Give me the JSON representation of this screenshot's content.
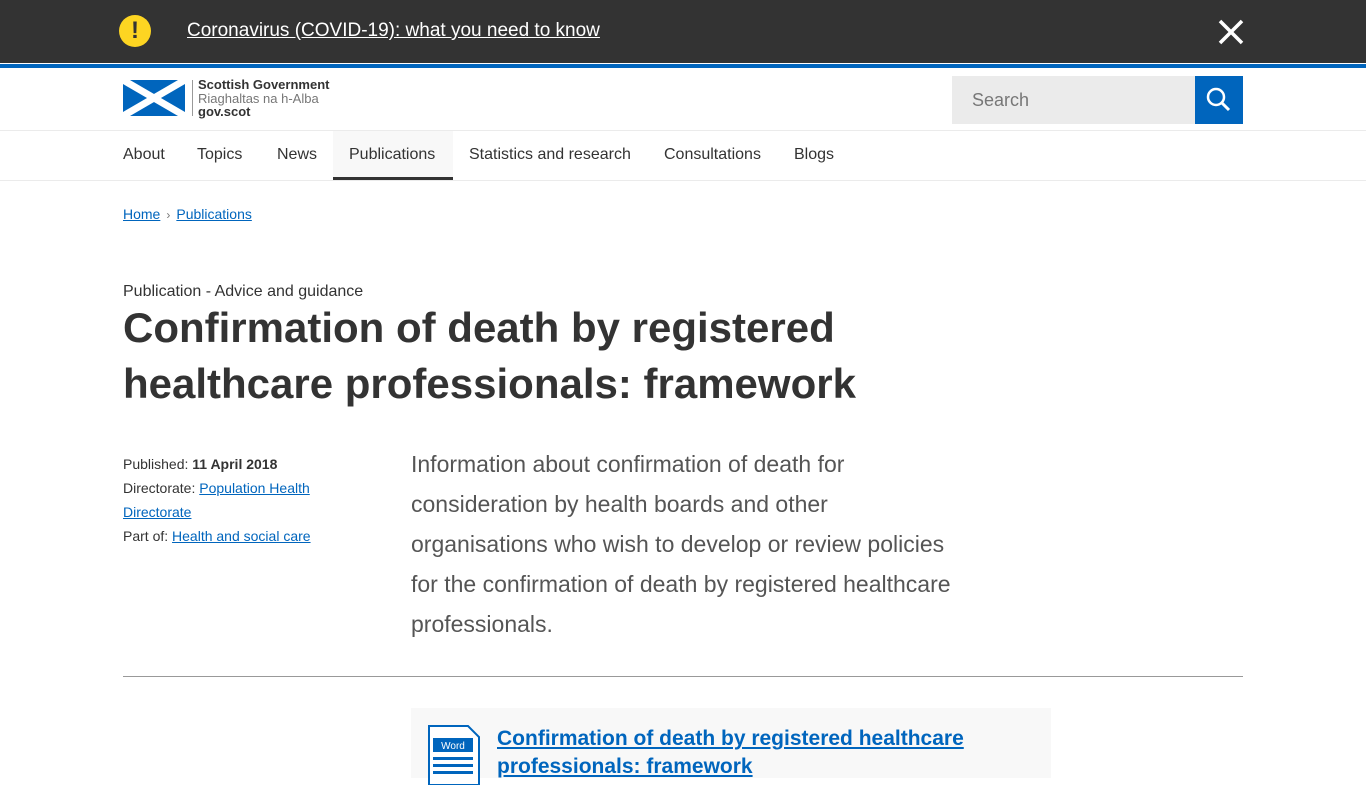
{
  "covid_banner": {
    "icon": "warning-icon",
    "link_text": "Coronavirus (COVID-19): what you need to know",
    "close_icon": "close-icon",
    "colors": {
      "background": "#333333",
      "warning": "#fdd522"
    }
  },
  "header": {
    "logo": {
      "line1": "Scottish Government",
      "line2": "Riaghaltas na h-Alba",
      "line3": "gov.scot"
    },
    "search": {
      "placeholder": "Search",
      "button_icon": "search-icon"
    },
    "brand_color": "#0065bd"
  },
  "nav": {
    "items": [
      {
        "label": "About"
      },
      {
        "label": "Topics"
      },
      {
        "label": "News"
      },
      {
        "label": "Publications",
        "active": true
      },
      {
        "label": "Statistics and research"
      },
      {
        "label": "Consultations"
      },
      {
        "label": "Blogs"
      }
    ]
  },
  "breadcrumb": {
    "items": [
      {
        "label": "Home"
      },
      {
        "label": "Publications"
      }
    ],
    "separator_icon": "chevron-right-icon"
  },
  "page": {
    "label": "Publication - Advice and guidance",
    "title": "Confirmation of death by registered healthcare professionals: framework",
    "meta": {
      "published_label": "Published:",
      "published_value": "11 April 2018",
      "directorate_label": "Directorate:",
      "directorate_value": "Population Health Directorate",
      "part_of_label": "Part of:",
      "part_of_value": "Health and social care"
    },
    "summary": "Information about confirmation of death for consideration by health boards and other organisations who wish to develop or review policies for the confirmation of death by registered healthcare professionals."
  },
  "document": {
    "file_type": "Word",
    "icon": "word-document-icon",
    "link_text": "Confirmation of death by registered healthcare professionals: framework"
  }
}
